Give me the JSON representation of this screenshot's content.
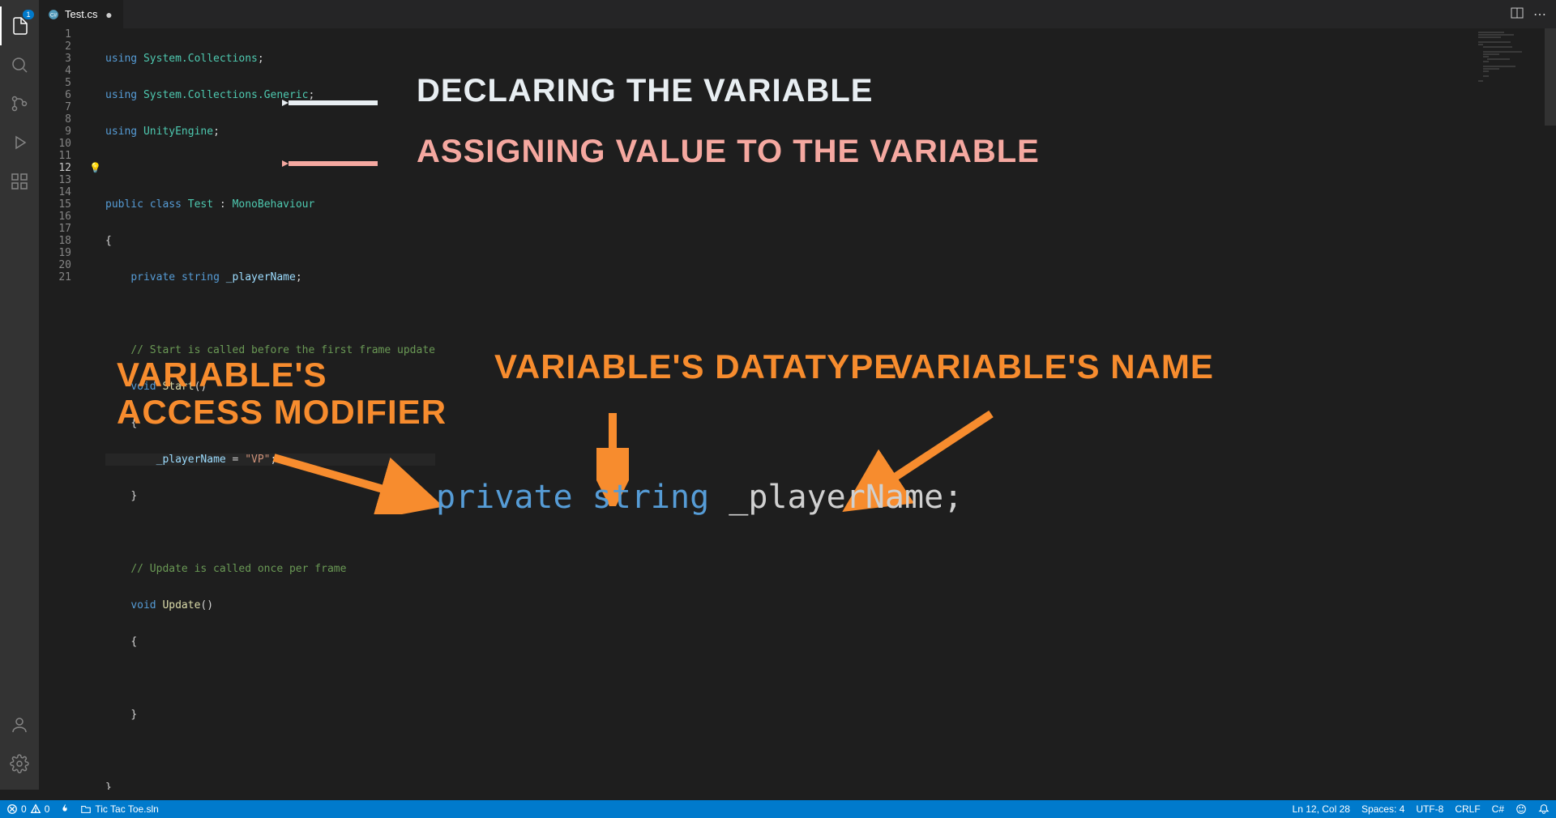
{
  "tab": {
    "name": "Test.cs",
    "modified": "●"
  },
  "activity_badge": "1",
  "line_numbers": [
    "1",
    "2",
    "3",
    "4",
    "5",
    "6",
    "7",
    "8",
    "9",
    "10",
    "11",
    "12",
    "13",
    "14",
    "15",
    "16",
    "17",
    "18",
    "19",
    "20",
    "21"
  ],
  "code": {
    "l1": {
      "kw": "using",
      "ns": "System.Collections",
      "p": ";"
    },
    "l2": {
      "kw": "using",
      "ns": "System.Collections.Generic",
      "p": ";"
    },
    "l3": {
      "kw": "using",
      "ns": "UnityEngine",
      "p": ";"
    },
    "l5": {
      "kw1": "public",
      "kw2": "class",
      "name": "Test",
      "colon": ":",
      "base": "MonoBehaviour"
    },
    "l6": "{",
    "l7": {
      "kw": "private",
      "type": "string",
      "var": "_playerName",
      "p": ";"
    },
    "l9": "// Start is called before the first frame update",
    "l10": {
      "kw": "void",
      "fn": "Start",
      "paren": "()"
    },
    "l11": "{",
    "l12": {
      "var": "_playerName",
      "eq": " = ",
      "str": "\"VP\"",
      "p": ";"
    },
    "l13": "}",
    "l15": "// Update is called once per frame",
    "l16": {
      "kw": "void",
      "fn": "Update",
      "paren": "()"
    },
    "l17": "{",
    "l19": "}",
    "l21": "}"
  },
  "annotations": {
    "declaring": "DECLARING THE VARIABLE",
    "assigning": "ASSIGNING VALUE TO THE VARIABLE",
    "access_modifier_1": "VARIABLE'S",
    "access_modifier_2": "ACCESS MODIFIER",
    "datatype": "VARIABLE'S DATATYPE",
    "name": "VARIABLE'S NAME"
  },
  "big_code": {
    "private": "private",
    "string": "string",
    "var": "_playerName",
    "semi": ";"
  },
  "status": {
    "errors": "0",
    "warnings": "0",
    "flame": "◇",
    "solution": "Tic Tac Toe.sln",
    "position": "Ln 12, Col 28",
    "spaces": "Spaces: 4",
    "encoding": "UTF-8",
    "eol": "CRLF",
    "lang": "C#",
    "feedback": "☺",
    "bell": "♪"
  },
  "colors": {
    "white_arrow": "#e8eef2",
    "pink": "#f5a8a0",
    "orange": "#f78c2e",
    "annotation_white": "#e8eef2"
  }
}
